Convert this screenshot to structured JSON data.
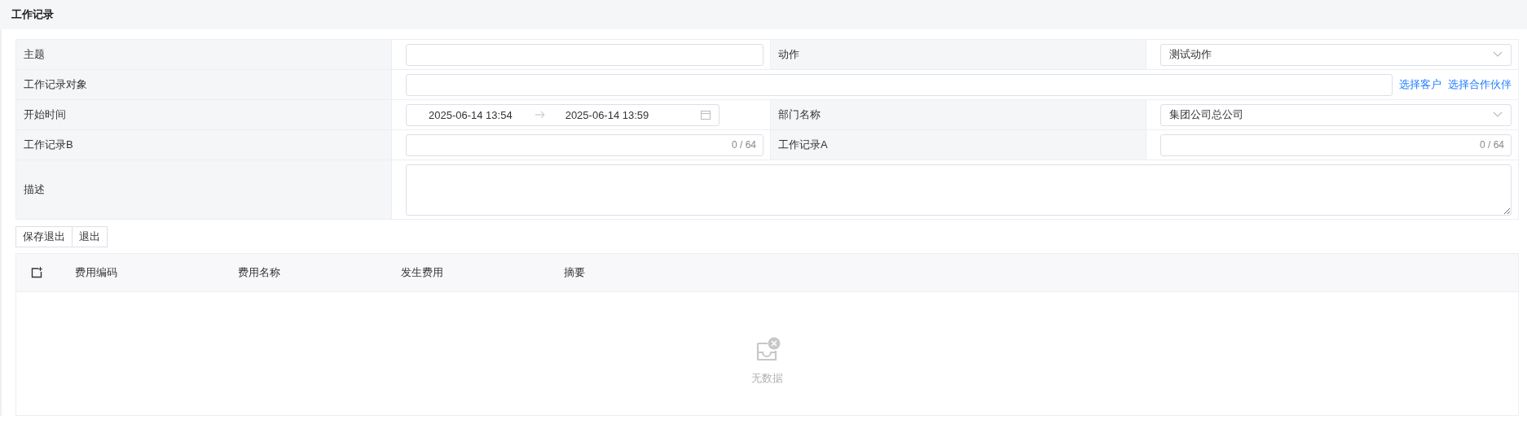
{
  "page": {
    "title": "工作记录"
  },
  "form": {
    "rows": [
      {
        "cells": [
          {
            "label": "主题",
            "field": {
              "kind": "text"
            }
          },
          {
            "label": "动作",
            "field": {
              "kind": "select",
              "value": "测试动作"
            }
          }
        ]
      },
      {
        "cells": [
          {
            "label": "工作记录对象",
            "field": {
              "kind": "picker",
              "links": [
                "选择客户",
                "选择合作伙伴"
              ]
            }
          }
        ]
      },
      {
        "cells": [
          {
            "label": "开始时间",
            "field": {
              "kind": "daterange",
              "start": "2025-06-14 13:54",
              "end": "2025-06-14 13:59"
            }
          },
          {
            "label": "部门名称",
            "field": {
              "kind": "select",
              "value": "集团公司总公司"
            }
          }
        ]
      },
      {
        "cells": [
          {
            "label": "工作记录B",
            "field": {
              "kind": "counter",
              "count": "0 / 64"
            }
          },
          {
            "label": "工作记录A",
            "field": {
              "kind": "counter",
              "count": "0 / 64"
            }
          }
        ]
      },
      {
        "cells": [
          {
            "label": "描述",
            "field": {
              "kind": "textarea"
            }
          }
        ]
      }
    ]
  },
  "buttons": [
    "保存退出",
    "退出"
  ],
  "table": {
    "columns": [
      "费用编码",
      "费用名称",
      "发生费用",
      "摘要"
    ],
    "empty_text": "无数据"
  }
}
